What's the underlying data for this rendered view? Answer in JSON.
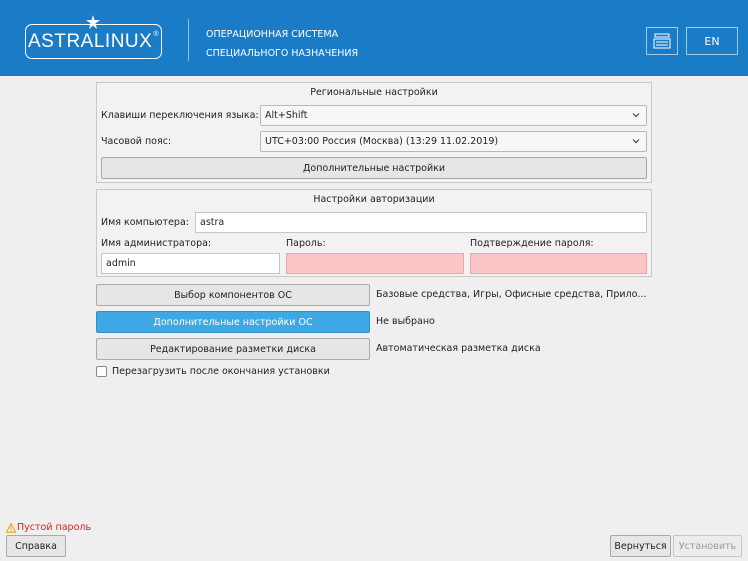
{
  "header": {
    "logo_text": "ASTRALINUX",
    "logo_mark": "®",
    "subtitle_line1": "ОПЕРАЦИОННАЯ СИСТЕМА",
    "subtitle_line2": "СПЕЦИАЛЬНОГО НАЗНАЧЕНИЯ",
    "keyboard_icon": "keyboard-icon",
    "language_button": "EN",
    "accent_color": "#1a7cc7"
  },
  "regional": {
    "title": "Региональные настройки",
    "lang_switch_label": "Клавиши переключения языка:",
    "lang_switch_value": "Alt+Shift",
    "timezone_label": "Часовой пояс:",
    "timezone_value": "UTC+03:00 Россия (Москва) (13:29 11.02.2019)",
    "extra_button": "Дополнительные настройки"
  },
  "auth": {
    "title": "Настройки авторизации",
    "hostname_label": "Имя компьютера:",
    "hostname_value": "astra",
    "admin_label": "Имя администратора:",
    "admin_value": "admin",
    "password_label": "Пароль:",
    "password_value": "",
    "confirm_label": "Подтверждение пароля:",
    "confirm_value": "",
    "error_color": "#fdc6c6"
  },
  "actions": {
    "components_button": "Выбор компонентов ОС",
    "components_value": "Базовые средства, Игры, Офисные средства, Прило...",
    "os_settings_button": "Дополнительные настройки ОС",
    "os_settings_value": "Не выбрано",
    "disk_button": "Редактирование разметки диска",
    "disk_value": "Автоматическая разметка диска",
    "reboot_label": "Перезагрузить после окончания установки",
    "reboot_checked": false
  },
  "footer": {
    "warning": "Пустой пароль",
    "help_button": "Справка",
    "back_button": "Вернуться",
    "install_button": "Установить"
  }
}
